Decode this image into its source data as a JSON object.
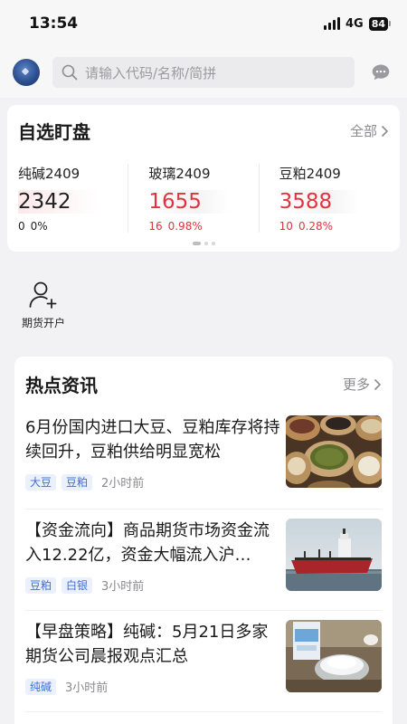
{
  "status_bar": {
    "time": "13:54",
    "network": "4G",
    "battery": "84"
  },
  "search": {
    "placeholder": "请输入代码/名称/简拼"
  },
  "watchlist": {
    "title": "自选盯盘",
    "more_label": "全部",
    "quotes": [
      {
        "name": "纯碱2409",
        "price": "2342",
        "change": "0",
        "change_pct": "0%",
        "trend": "neutral"
      },
      {
        "name": "玻璃2409",
        "price": "1655",
        "change": "16",
        "change_pct": "0.98%",
        "trend": "up"
      },
      {
        "name": "豆粕2409",
        "price": "3588",
        "change": "10",
        "change_pct": "0.28%",
        "trend": "up"
      }
    ]
  },
  "shortcut": {
    "label": "期货开户",
    "icon": "add-user-icon"
  },
  "news": {
    "title": "热点资讯",
    "more_label": "更多",
    "items": [
      {
        "title": "6月份国内进口大豆、豆粕库存将持续回升，豆粕供给明显宽松",
        "tags": [
          "大豆",
          "豆粕"
        ],
        "time": "2小时前",
        "image": "grain-sacks"
      },
      {
        "title": "【资金流向】商品期货市场资金流入12.22亿，资金大幅流入沪…",
        "tags": [
          "豆粕",
          "白银"
        ],
        "time": "3小时前",
        "image": "cargo-ship"
      },
      {
        "title": "【早盘策略】纯碱：5月21日多家期货公司晨报观点汇总",
        "tags": [
          "纯碱"
        ],
        "time": "3小时前",
        "image": "soda-powder"
      }
    ]
  },
  "colors": {
    "up": "#e2333f",
    "tag_text": "#3d6fd6",
    "tag_bg": "#eaf0fc"
  }
}
